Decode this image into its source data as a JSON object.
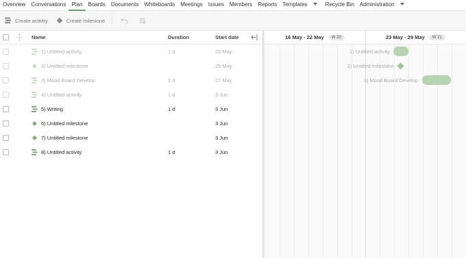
{
  "nav": {
    "items": [
      {
        "label": "Overview"
      },
      {
        "label": "Conversations"
      },
      {
        "label": "Plan",
        "active": true
      },
      {
        "label": "Boards"
      },
      {
        "label": "Documents"
      },
      {
        "label": "Whiteboards"
      },
      {
        "label": "Meetings"
      },
      {
        "label": "Issues"
      },
      {
        "label": "Members"
      },
      {
        "label": "Reports"
      },
      {
        "label": "Templates",
        "dropdown": true
      },
      {
        "label": "Recycle Bin"
      },
      {
        "label": "Administration",
        "dropdown": true
      }
    ]
  },
  "toolbar": {
    "create_activity": "Create activity",
    "create_milestone": "Create milestone",
    "undo_icon": "undo-icon",
    "redo_icon": "redo-icon"
  },
  "grid": {
    "columns": {
      "name": "Name",
      "duration": "Duration",
      "start": "Start date"
    },
    "rows": [
      {
        "name": "1) Untitled activity",
        "duration": "1 d",
        "start": "25 May",
        "type": "activity",
        "state": "faded"
      },
      {
        "name": "2) Untitled milestone",
        "duration": "",
        "start": "25 May",
        "type": "milestone",
        "state": "faded"
      },
      {
        "name": "3) Mood Board Develop",
        "duration": "2 d",
        "start": "27 May",
        "type": "activity",
        "state": "faded"
      },
      {
        "name": "4) Untitled activity",
        "duration": "1 d",
        "start": "3 Jun",
        "type": "activity",
        "state": "faded"
      },
      {
        "name": "5) Writing",
        "duration": "1 d",
        "start": "3 Jun",
        "type": "activity",
        "state": "active"
      },
      {
        "name": "6) Untitled milestone",
        "duration": "",
        "start": "3 Jun",
        "type": "milestone",
        "state": "active"
      },
      {
        "name": "7) Untitled milestone",
        "duration": "",
        "start": "3 Jun",
        "type": "milestone",
        "state": "active"
      },
      {
        "name": "8) Untitled activity",
        "duration": "1 d",
        "start": "3 Jun",
        "type": "activity",
        "state": "active"
      }
    ]
  },
  "timeline": {
    "weeks": [
      {
        "range": "16 May - 22 May",
        "badge": "W 20"
      },
      {
        "range": "23 May - 29 May",
        "badge": "W 21"
      }
    ],
    "tasks": [
      {
        "label": "1) Untitled activity"
      },
      {
        "label": "2) Untitled milestone"
      },
      {
        "label": "3) Mood Board Develop"
      }
    ]
  },
  "colors": {
    "accent": "#6f9f6f",
    "bar": "#b7d4b0",
    "milestone": "#9cc39a"
  }
}
